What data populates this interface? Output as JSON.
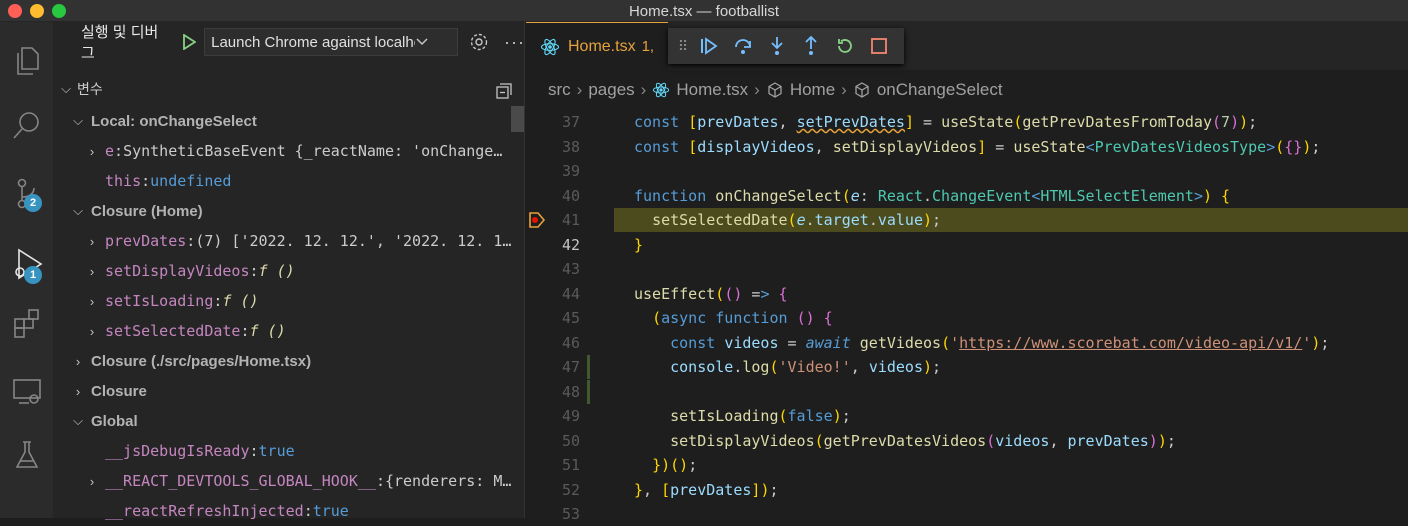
{
  "window": {
    "title": "Home.tsx — footballist"
  },
  "activity_bar": {
    "items": [
      {
        "icon": "explorer-icon"
      },
      {
        "icon": "search-icon"
      },
      {
        "icon": "source-control-icon",
        "badge": "2"
      },
      {
        "icon": "run-debug-icon",
        "badge": "1"
      },
      {
        "icon": "extensions-icon"
      },
      {
        "icon": "remote-explorer-icon"
      },
      {
        "icon": "testing-icon"
      }
    ]
  },
  "sidebar": {
    "title": "실행 및 디버그",
    "launch_config": "Launch Chrome against localhost",
    "variables_header": "변수",
    "rows": [
      {
        "kind": "section",
        "indent": 1,
        "chev": "v",
        "label": "Local: onChangeSelect"
      },
      {
        "kind": "var",
        "indent": 2,
        "chev": ">",
        "name": "e",
        "value": "SyntheticBaseEvent {_reactName: 'onChange…",
        "style": "val"
      },
      {
        "kind": "var",
        "indent": 2,
        "chev": "",
        "name": "this",
        "value": "undefined",
        "style": "kw"
      },
      {
        "kind": "section",
        "indent": 1,
        "chev": "v",
        "label": "Closure (Home)"
      },
      {
        "kind": "var",
        "indent": 2,
        "chev": ">",
        "name": "prevDates",
        "value": "(7) ['2022. 12. 12.', '2022. 12. 1…",
        "style": "val"
      },
      {
        "kind": "var",
        "indent": 2,
        "chev": ">",
        "name": "setDisplayVideos",
        "value": "f ()",
        "style": "fn"
      },
      {
        "kind": "var",
        "indent": 2,
        "chev": ">",
        "name": "setIsLoading",
        "value": "f ()",
        "style": "fn"
      },
      {
        "kind": "var",
        "indent": 2,
        "chev": ">",
        "name": "setSelectedDate",
        "value": "f ()",
        "style": "fn"
      },
      {
        "kind": "section",
        "indent": 1,
        "chev": ">",
        "label": "Closure (./src/pages/Home.tsx)"
      },
      {
        "kind": "section",
        "indent": 1,
        "chev": ">",
        "label": "Closure"
      },
      {
        "kind": "section",
        "indent": 1,
        "chev": "v",
        "label": "Global"
      },
      {
        "kind": "var",
        "indent": 2,
        "chev": "",
        "name": "__jsDebugIsReady",
        "value": "true",
        "style": "kw"
      },
      {
        "kind": "var",
        "indent": 2,
        "chev": ">",
        "name": "__REACT_DEVTOOLS_GLOBAL_HOOK__",
        "value": "{renderers: M…",
        "style": "val"
      },
      {
        "kind": "var",
        "indent": 2,
        "chev": "",
        "name": "__reactRefreshInjected",
        "value": "true",
        "style": "kw"
      }
    ]
  },
  "editor": {
    "tab": {
      "name": "Home.tsx",
      "suffix": "1,"
    },
    "breadcrumb": [
      "src",
      "pages",
      "Home.tsx",
      "Home",
      "onChangeSelect"
    ],
    "current_line": "42",
    "breakpoint_line": "41",
    "lines": [
      {
        "n": "37",
        "code": "const [prevDates, setPrevDates] = useState(getPrevDatesFromToday(7));"
      },
      {
        "n": "38",
        "code": "const [displayVideos, setDisplayVideos] = useState<PrevDatesVideosType>({});"
      },
      {
        "n": "39",
        "code": ""
      },
      {
        "n": "40",
        "code": "function onChangeSelect(e: React.ChangeEvent<HTMLSelectElement>) {"
      },
      {
        "n": "41",
        "code": "  setSelectedDate(e.target.value);"
      },
      {
        "n": "42",
        "code": "}"
      },
      {
        "n": "43",
        "code": ""
      },
      {
        "n": "44",
        "code": "useEffect(() => {"
      },
      {
        "n": "45",
        "code": "  (async function () {"
      },
      {
        "n": "46",
        "code": "    const videos = await getVideos('https://www.scorebat.com/video-api/v1/');"
      },
      {
        "n": "47",
        "code": "    console.log('Video!', videos);"
      },
      {
        "n": "48",
        "code": ""
      },
      {
        "n": "49",
        "code": "    setIsLoading(false);"
      },
      {
        "n": "50",
        "code": "    setDisplayVideos(getPrevDatesVideos(videos, prevDates));"
      },
      {
        "n": "51",
        "code": "  })();"
      },
      {
        "n": "52",
        "code": "}, [prevDates]);"
      },
      {
        "n": "53",
        "code": ""
      }
    ]
  }
}
